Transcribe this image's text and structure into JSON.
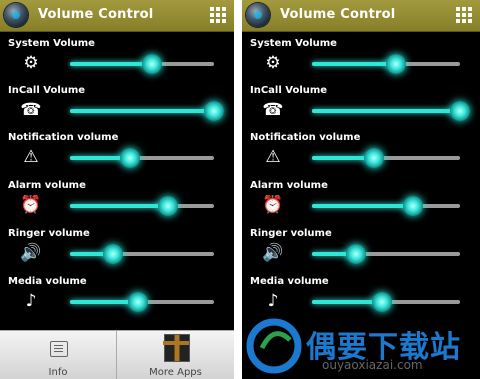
{
  "app": {
    "title": "Volume Control",
    "grid_icon": "grid-menu-icon"
  },
  "rows": [
    {
      "label": "System Volume",
      "icon": "gear-icon",
      "value": 0.57
    },
    {
      "label": "InCall Volume",
      "icon": "phone-icon",
      "value": 1.0
    },
    {
      "label": "Notification volume",
      "icon": "warning-icon",
      "value": 0.42
    },
    {
      "label": "Alarm volume",
      "icon": "alarm-clock-icon",
      "value": 0.68
    },
    {
      "label": "Ringer volume",
      "icon": "speaker-icon",
      "value": 0.3
    },
    {
      "label": "Media volume",
      "icon": "music-note-icon",
      "value": 0.47
    }
  ],
  "rows_right": [
    0.57,
    1.0,
    0.42,
    0.68,
    0.3,
    0.47
  ],
  "bottom": {
    "info_label": "Info",
    "more_label": "More Apps"
  },
  "watermark": {
    "title": "偶要下载站",
    "url": "ouyaoxiazai.com"
  },
  "colors": {
    "accent": "#2fe6d8",
    "titlebar": "#958d33"
  }
}
